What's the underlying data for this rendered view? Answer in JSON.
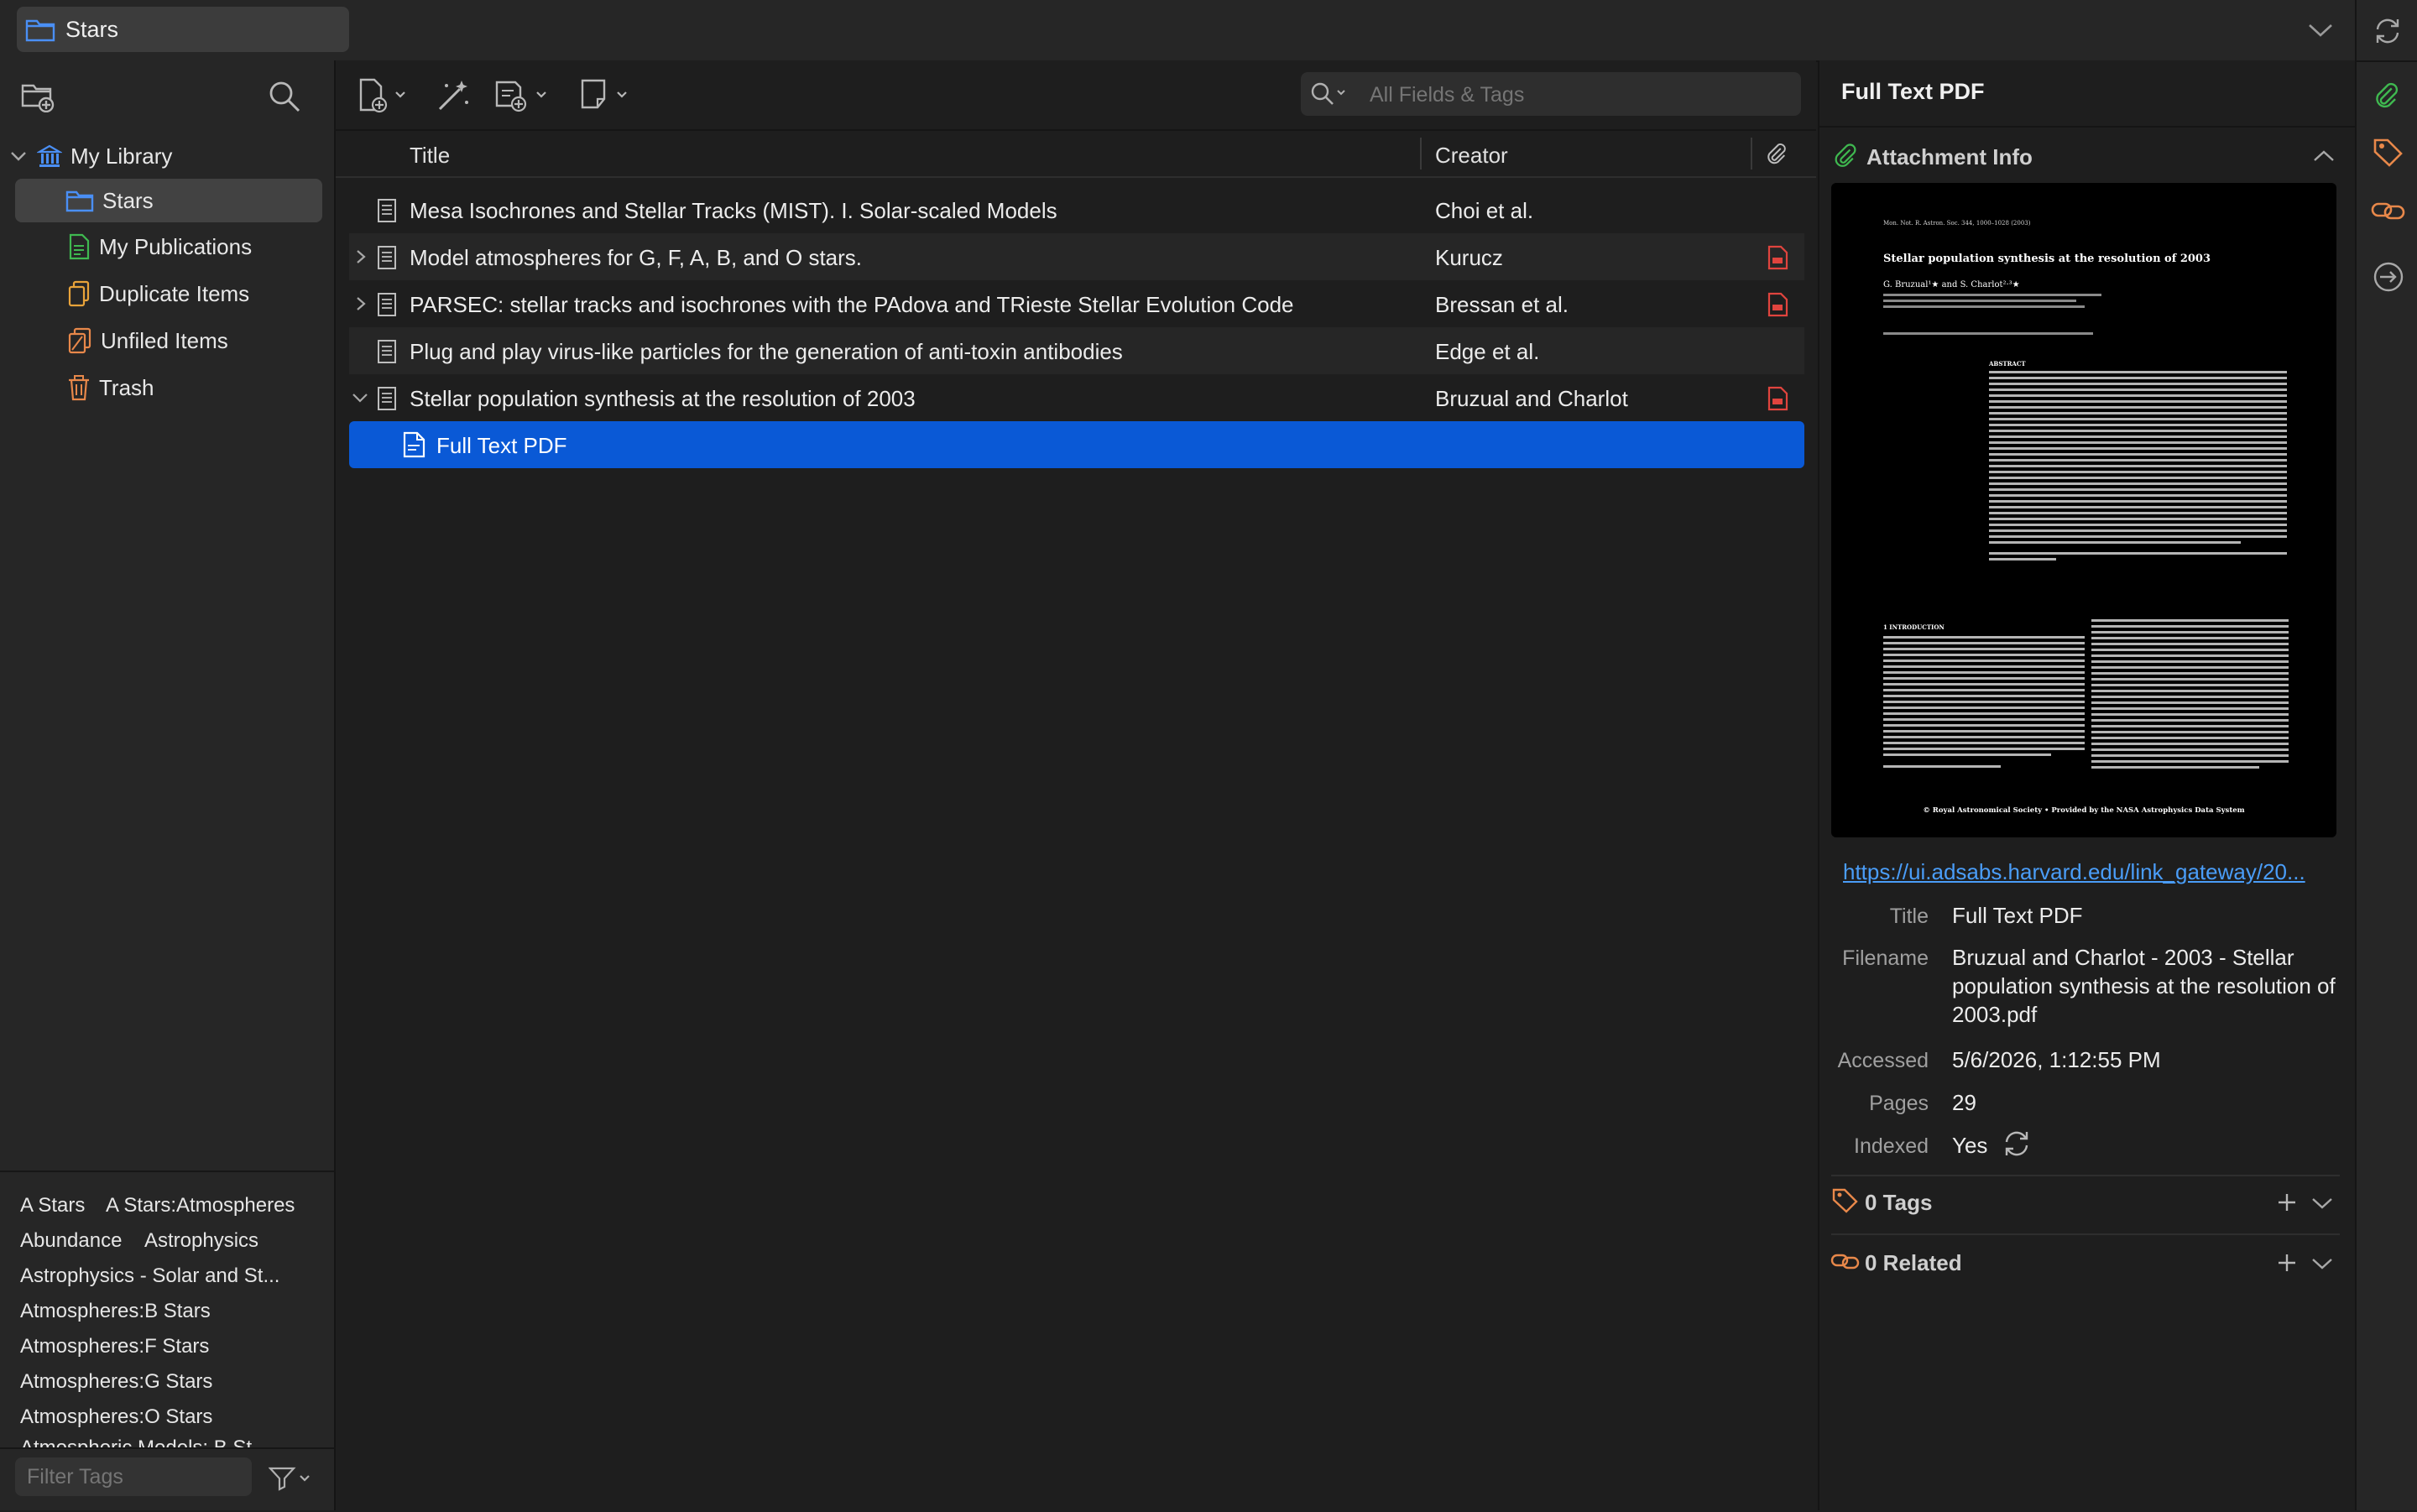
{
  "window": {
    "library_title": "Stars"
  },
  "left_pane": {
    "tree": [
      {
        "label": "My Library",
        "icon": "library-icon"
      },
      {
        "label": "Stars",
        "icon": "folder-icon"
      },
      {
        "label": "My Publications",
        "icon": "publications-icon"
      },
      {
        "label": "Duplicate Items",
        "icon": "duplicate-icon"
      },
      {
        "label": "Unfiled Items",
        "icon": "unfiled-icon"
      },
      {
        "label": "Trash",
        "icon": "trash-icon"
      }
    ],
    "tags": [
      "A Stars",
      "A Stars:Atmospheres",
      "Abundance",
      "Astrophysics",
      "Astrophysics - Solar and St...",
      "Atmospheres:B Stars",
      "Atmospheres:F Stars",
      "Atmospheres:G Stars",
      "Atmospheres:O Stars",
      "Atmospheric Models: B St..."
    ],
    "tag_filter_placeholder": "Filter Tags"
  },
  "mid_pane": {
    "search_placeholder": "All Fields & Tags",
    "columns": {
      "title": "Title",
      "creator": "Creator"
    },
    "rows": [
      {
        "title": "Mesa Isochrones and Stellar Tracks (MIST). I. Solar-scaled Models",
        "creator": "Choi et al.",
        "attachment": false,
        "expander": "none"
      },
      {
        "title": "Model atmospheres for G, F, A, B, and O stars.",
        "creator": "Kurucz",
        "attachment": true,
        "expander": "collapsed"
      },
      {
        "title": "PARSEC: stellar tracks and isochrones with the PAdova and TRieste Stellar Evolution Code",
        "creator": "Bressan et al.",
        "attachment": true,
        "expander": "collapsed"
      },
      {
        "title": "Plug and play virus-like particles for the generation of anti-toxin antibodies",
        "creator": "Edge et al.",
        "attachment": false,
        "expander": "none"
      },
      {
        "title": "Stellar population synthesis at the resolution of 2003",
        "creator": "Bruzual and Charlot",
        "attachment": true,
        "expander": "expanded"
      },
      {
        "title": "Full Text PDF",
        "creator": "",
        "attachment": false,
        "expander": "child"
      }
    ]
  },
  "right_pane": {
    "header_title": "Full Text PDF",
    "attachment_section": "Attachment Info",
    "url": "https://ui.adsabs.harvard.edu/link_gateway/20...",
    "fields": {
      "title_label": "Title",
      "title_value": "Full Text PDF",
      "filename_label": "Filename",
      "filename_value": "Bruzual and Charlot - 2003 - Stellar population synthesis at the resolution of 2003.pdf",
      "accessed_label": "Accessed",
      "accessed_value": "5/6/2026, 1:12:55 PM",
      "pages_label": "Pages",
      "pages_value": "29",
      "indexed_label": "Indexed",
      "indexed_value": "Yes"
    },
    "tags_section": "0 Tags",
    "related_section": "0 Related",
    "pdf_preview": {
      "journal_line": "Mon. Not. R. Astron. Soc. 344, 1000–1028 (2003)",
      "title": "Stellar population synthesis at the resolution of 2003",
      "authors": "G. Bruzual¹★ and S. Charlot²·³★",
      "abstract_heading": "ABSTRACT",
      "intro_heading": "1 INTRODUCTION",
      "footer": "© Royal Astronomical Society • Provided by the NASA Astrophysics Data System"
    }
  },
  "colors": {
    "selection": "#0a59d6",
    "link": "#4a9df8",
    "green_icon": "#3fb950",
    "orange_icon": "#e8884a",
    "pdf_icon_red": "#e0443e"
  }
}
